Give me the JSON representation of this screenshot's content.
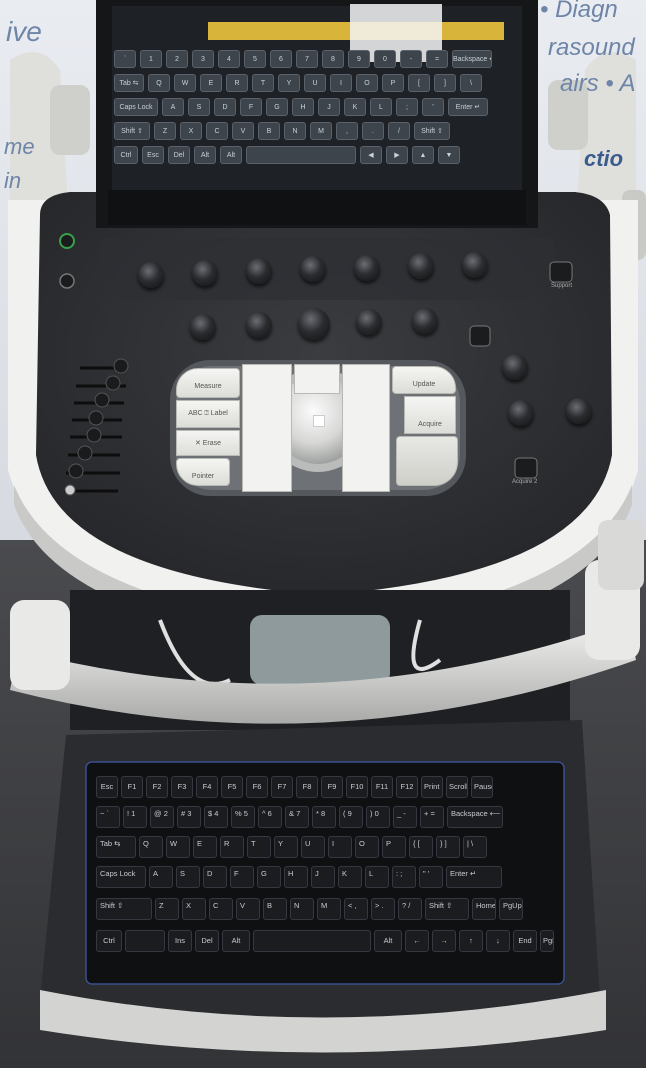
{
  "poster": {
    "left_lines": [
      "ive",
      "me",
      "in"
    ],
    "right_lines": [
      "• Diagn",
      "rasound",
      "airs • A",
      "ctio"
    ]
  },
  "touchscreen": {
    "rows": [
      [
        "`",
        "1",
        "2",
        "3",
        "4",
        "5",
        "6",
        "7",
        "8",
        "9",
        "0",
        "-",
        "=",
        "Backspace ⟵"
      ],
      [
        "Tab ⇆",
        "Q",
        "W",
        "E",
        "R",
        "T",
        "Y",
        "U",
        "I",
        "O",
        "P",
        "[",
        "]",
        "\\"
      ],
      [
        "Caps Lock",
        "A",
        "S",
        "D",
        "F",
        "G",
        "H",
        "J",
        "K",
        "L",
        ";",
        "'",
        "Enter ↵"
      ],
      [
        "Shift ⇧",
        "Z",
        "X",
        "C",
        "V",
        "B",
        "N",
        "M",
        ",",
        ".",
        "/",
        "Shift ⇧"
      ],
      [
        "Ctrl",
        "Esc",
        "Del",
        "Alt",
        "Alt",
        "",
        "◀",
        "▶",
        "▲",
        "▼"
      ]
    ]
  },
  "control_panel": {
    "buttons": {
      "measure": "Measure",
      "label": "ABC ⍰ Label",
      "erase": "✕ Erase",
      "pointer": "Pointer",
      "update": "Update",
      "acquire": "Acquire",
      "support": "Support",
      "acquire2": "Acquire 2"
    }
  },
  "keyboard": {
    "rows": [
      [
        "Esc",
        "F1",
        "F2",
        "F3",
        "F4",
        "F5",
        "F6",
        "F7",
        "F8",
        "F9",
        "F10",
        "F11",
        "F12",
        "Print Screen",
        "Scroll Lock",
        "Pause"
      ],
      [
        "~ `",
        "! 1",
        "@ 2",
        "# 3",
        "$ 4",
        "% 5",
        "^ 6",
        "& 7",
        "* 8",
        "( 9",
        ") 0",
        "_ -",
        "+ =",
        "Backspace ⟵"
      ],
      [
        "Tab ⇆",
        "Q",
        "W",
        "E",
        "R",
        "T",
        "Y",
        "U",
        "I",
        "O",
        "P",
        "{ [",
        "} ]",
        "| \\"
      ],
      [
        "Caps Lock",
        "A",
        "S",
        "D",
        "F",
        "G",
        "H",
        "J",
        "K",
        "L",
        ": ;",
        "\" '",
        "Enter ↵"
      ],
      [
        "Shift ⇧",
        "Z",
        "X",
        "C",
        "V",
        "B",
        "N",
        "M",
        "< ,",
        "> .",
        "? /",
        "Shift ⇧",
        "Home",
        "PgUp"
      ],
      [
        "Ctrl",
        "",
        "Ins",
        "Del",
        "Alt",
        "",
        "Alt",
        "←",
        "→",
        "↑",
        "↓",
        "End",
        "PgDn"
      ]
    ]
  }
}
